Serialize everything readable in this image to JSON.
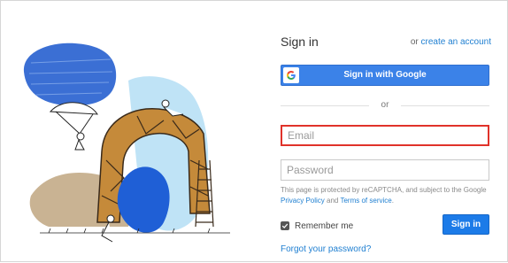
{
  "signin": {
    "title": "Sign in",
    "or_prefix": "or",
    "create_account": "create an account",
    "google_button": "Sign in with Google",
    "or_divider": "or",
    "email_placeholder": "Email",
    "password_placeholder": "Password",
    "recaptcha_prefix": "This page is protected by reCAPTCHA, and subject to the Google",
    "privacy_policy": "Privacy Policy",
    "recaptcha_and": "and",
    "terms_of_service": "Terms of service",
    "recaptcha_suffix": ".",
    "remember_me": "Remember me",
    "remember_checked": true,
    "signin_button": "Sign in",
    "forgot_password": "Forgot your password?"
  },
  "colors": {
    "primary_blue": "#1c7be8",
    "google_blue": "#3b82e8",
    "link_blue": "#1f7fd1",
    "error_red": "#e0322a"
  },
  "icons": {
    "google": "google-g-icon",
    "checkbox": "checkmark-icon"
  }
}
